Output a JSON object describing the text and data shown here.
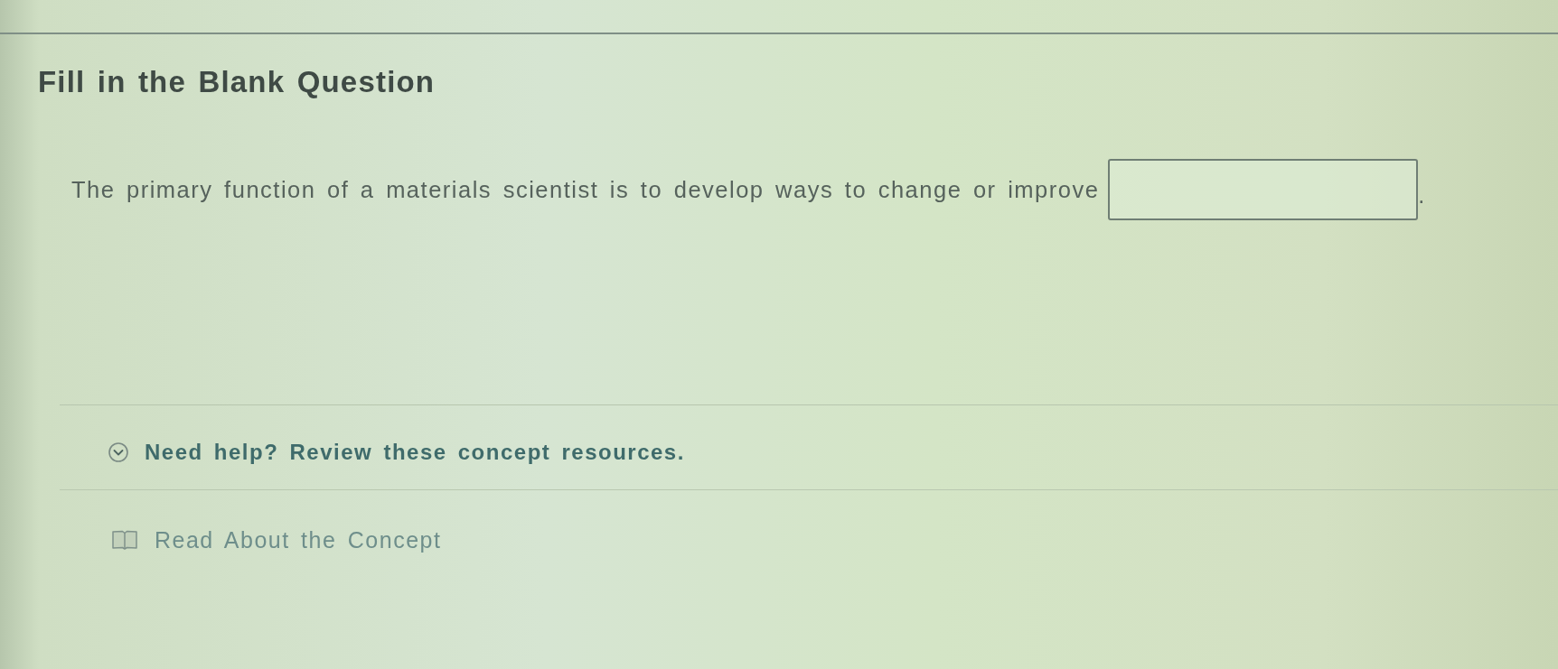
{
  "header": {
    "title": "Fill in the Blank Question"
  },
  "question": {
    "parts": [
      {
        "kind": "text",
        "text": "The primary function of a materials scientist is to develop ways to change or improve"
      },
      {
        "kind": "blank"
      },
      {
        "kind": "text",
        "text": "."
      }
    ]
  },
  "help": {
    "label": "Need help? Review these concept resources."
  },
  "resources": [
    {
      "kind": "read",
      "label": "Read About the Concept"
    }
  ]
}
